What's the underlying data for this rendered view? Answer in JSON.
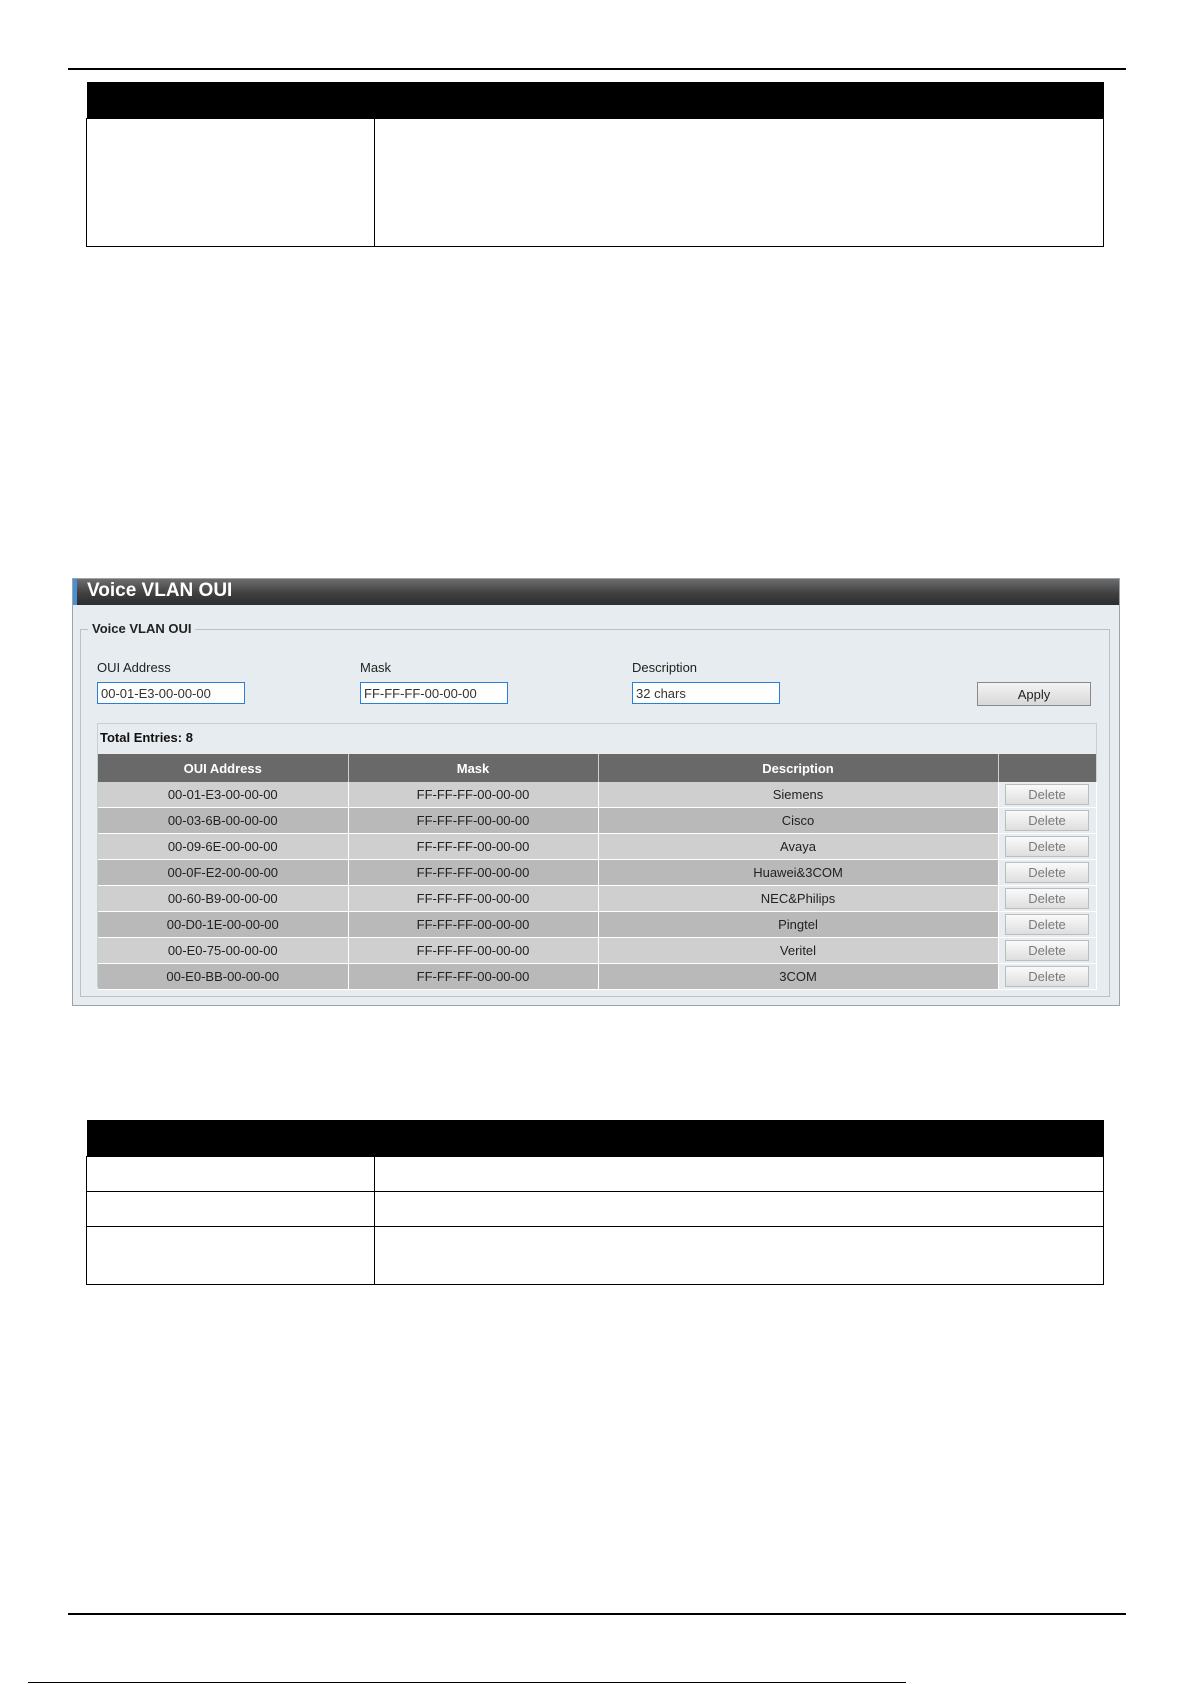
{
  "panel": {
    "title": "Voice VLAN OUI",
    "legend": "Voice VLAN OUI",
    "fields": {
      "oui_label": "OUI Address",
      "oui_value": "00-01-E3-00-00-00",
      "mask_label": "Mask",
      "mask_value": "FF-FF-FF-00-00-00",
      "desc_label": "Description",
      "desc_placeholder": "32 chars"
    },
    "apply_label": "Apply",
    "total_entries": "Total Entries: 8",
    "columns": [
      "OUI Address",
      "Mask",
      "Description",
      ""
    ],
    "delete_label": "Delete",
    "rows": [
      {
        "oui": "00-01-E3-00-00-00",
        "mask": "FF-FF-FF-00-00-00",
        "desc": "Siemens"
      },
      {
        "oui": "00-03-6B-00-00-00",
        "mask": "FF-FF-FF-00-00-00",
        "desc": "Cisco"
      },
      {
        "oui": "00-09-6E-00-00-00",
        "mask": "FF-FF-FF-00-00-00",
        "desc": "Avaya"
      },
      {
        "oui": "00-0F-E2-00-00-00",
        "mask": "FF-FF-FF-00-00-00",
        "desc": "Huawei&3COM"
      },
      {
        "oui": "00-60-B9-00-00-00",
        "mask": "FF-FF-FF-00-00-00",
        "desc": "NEC&Philips"
      },
      {
        "oui": "00-D0-1E-00-00-00",
        "mask": "FF-FF-FF-00-00-00",
        "desc": "Pingtel"
      },
      {
        "oui": "00-E0-75-00-00-00",
        "mask": "FF-FF-FF-00-00-00",
        "desc": "Veritel"
      },
      {
        "oui": "00-E0-BB-00-00-00",
        "mask": "FF-FF-FF-00-00-00",
        "desc": "3COM"
      }
    ]
  },
  "colors": {
    "title_bar": "#404040",
    "panel_bg": "#e6ecef",
    "table_header": "#696969",
    "row_odd": "#cfcfcf",
    "row_even": "#b9b9b9",
    "input_border": "#2a7fd1"
  }
}
